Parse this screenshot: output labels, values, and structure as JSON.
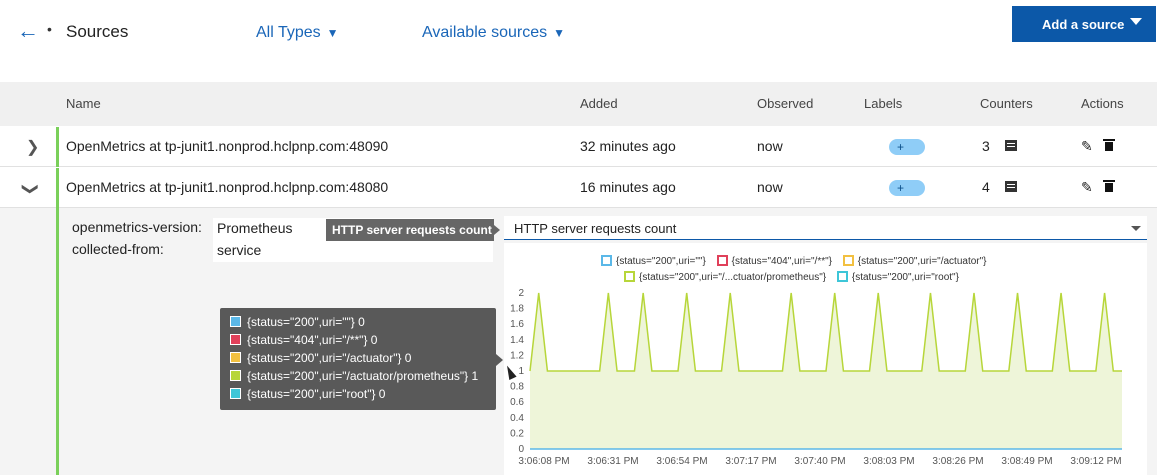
{
  "header": {
    "title": "Sources",
    "filter_types": "All Types",
    "filter_sources": "Available sources",
    "add_button": "Add a source"
  },
  "table": {
    "columns": [
      "Name",
      "Added",
      "Observed",
      "Labels",
      "Counters",
      "Actions"
    ],
    "rows": [
      {
        "name": "OpenMetrics at tp-junit1.nonprod.hclpnp.com:48090",
        "added": "32 minutes ago",
        "observed": "now",
        "labels_button": "+",
        "counters": "3",
        "expanded": false
      },
      {
        "name": "OpenMetrics at tp-junit1.nonprod.hclpnp.com:48080",
        "added": "16 minutes ago",
        "observed": "now",
        "labels_button": "+",
        "counters": "4",
        "expanded": true
      }
    ]
  },
  "detail": {
    "meta": [
      {
        "key": "openmetrics-version:",
        "value": "Prometheus"
      },
      {
        "key": "collected-from:",
        "value": "service"
      }
    ],
    "counter_tooltip": "HTTP server requests count",
    "counter_select": "HTTP server requests count"
  },
  "chart_data": {
    "type": "line",
    "title": "",
    "y_ticks": [
      "2",
      "1.8",
      "1.6",
      "1.4",
      "1.2",
      "1",
      "0.8",
      "0.6",
      "0.4",
      "0.2",
      "0"
    ],
    "ylim": [
      0,
      2
    ],
    "x_ticks": [
      "3:06:08 PM",
      "3:06:31 PM",
      "3:06:54 PM",
      "3:07:17 PM",
      "3:07:40 PM",
      "3:08:03 PM",
      "3:08:26 PM",
      "3:08:49 PM",
      "3:09:12 PM"
    ],
    "legend": [
      {
        "label": "{status=\"200\",uri=\"\"}",
        "color": "#5bb8e8"
      },
      {
        "label": "{status=\"404\",uri=\"/**\"}",
        "color": "#e0405a"
      },
      {
        "label": "{status=\"200\",uri=\"/actuator\"}",
        "color": "#f2c040"
      },
      {
        "label": "{status=\"200\",uri=\"/...ctuator/prometheus\"}",
        "color": "#b7d63a"
      },
      {
        "label": "{status=\"200\",uri=\"root\"}",
        "color": "#3ec6d8"
      }
    ],
    "series": [
      {
        "name": "{status=\"200\",uri=\"/actuator/prometheus\"}",
        "color": "#b7d63a",
        "values": [
          1,
          2,
          1,
          1,
          1,
          1,
          1,
          1,
          1,
          2,
          1,
          1,
          1,
          2,
          1,
          1,
          1,
          1,
          2,
          1,
          1,
          1,
          1,
          2,
          1,
          1,
          1,
          1,
          1,
          1,
          2,
          1,
          1,
          1,
          1,
          2,
          1,
          1,
          1,
          1,
          2,
          1,
          1,
          1,
          1,
          1,
          2,
          1,
          1,
          1,
          1,
          2,
          1,
          1,
          1,
          1,
          2,
          1,
          1,
          1,
          1,
          2,
          1,
          1,
          1,
          1,
          2,
          1,
          1
        ]
      },
      {
        "name": "{status=\"200\",uri=\"\"}",
        "color": "#5bb8e8",
        "values": [
          0,
          0
        ]
      }
    ]
  },
  "hover_tooltip": [
    {
      "label": "{status=\"200\",uri=\"\"} 0",
      "color": "#5bb8e8"
    },
    {
      "label": "{status=\"404\",uri=\"/**\"} 0",
      "color": "#e0405a"
    },
    {
      "label": "{status=\"200\",uri=\"/actuator\"} 0",
      "color": "#f2c040"
    },
    {
      "label": "{status=\"200\",uri=\"/actuator/prometheus\"} 1",
      "color": "#b7d63a"
    },
    {
      "label": "{status=\"200\",uri=\"root\"} 0",
      "color": "#3ec6d8"
    }
  ]
}
